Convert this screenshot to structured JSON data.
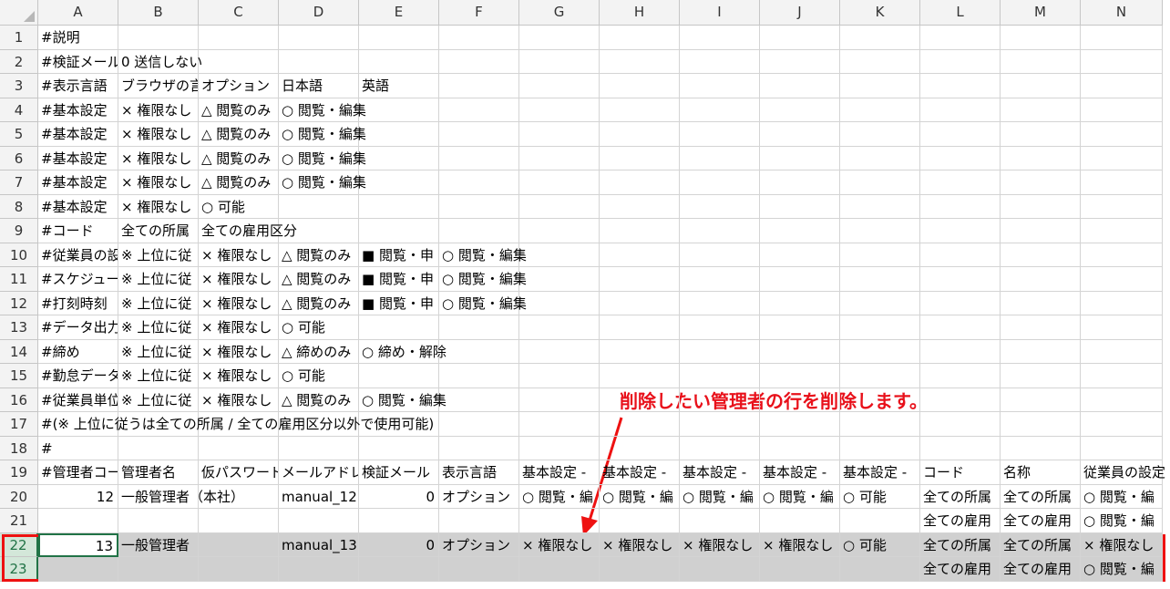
{
  "columns": [
    "A",
    "B",
    "C",
    "D",
    "E",
    "F",
    "G",
    "H",
    "I",
    "J",
    "K",
    "L",
    "M",
    "N"
  ],
  "rows": [
    {
      "n": "1",
      "cells": [
        "#説明",
        "",
        "",
        "",
        "",
        "",
        "",
        "",
        "",
        "",
        "",
        "",
        "",
        ""
      ]
    },
    {
      "n": "2",
      "cells": [
        "#検証メール",
        "0 送信しない",
        "",
        "",
        "",
        "",
        "",
        "",
        "",
        "",
        "",
        "",
        "",
        ""
      ]
    },
    {
      "n": "3",
      "cells": [
        "#表示言語",
        "ブラウザの言",
        "オプション",
        "日本語",
        "英語",
        "",
        "",
        "",
        "",
        "",
        "",
        "",
        "",
        ""
      ]
    },
    {
      "n": "4",
      "cells": [
        "#基本設定",
        "× 権限なし",
        "△ 閲覧のみ",
        "○ 閲覧・編集",
        "",
        "",
        "",
        "",
        "",
        "",
        "",
        "",
        "",
        ""
      ]
    },
    {
      "n": "5",
      "cells": [
        "#基本設定",
        "× 権限なし",
        "△ 閲覧のみ",
        "○ 閲覧・編集",
        "",
        "",
        "",
        "",
        "",
        "",
        "",
        "",
        "",
        ""
      ]
    },
    {
      "n": "6",
      "cells": [
        "#基本設定",
        "× 権限なし",
        "△ 閲覧のみ",
        "○ 閲覧・編集",
        "",
        "",
        "",
        "",
        "",
        "",
        "",
        "",
        "",
        ""
      ]
    },
    {
      "n": "7",
      "cells": [
        "#基本設定",
        "× 権限なし",
        "△ 閲覧のみ",
        "○ 閲覧・編集",
        "",
        "",
        "",
        "",
        "",
        "",
        "",
        "",
        "",
        ""
      ]
    },
    {
      "n": "8",
      "cells": [
        "#基本設定",
        "× 権限なし",
        "○ 可能",
        "",
        "",
        "",
        "",
        "",
        "",
        "",
        "",
        "",
        "",
        ""
      ]
    },
    {
      "n": "9",
      "cells": [
        "#コード",
        "全ての所属",
        "全ての雇用区分",
        "",
        "",
        "",
        "",
        "",
        "",
        "",
        "",
        "",
        "",
        ""
      ]
    },
    {
      "n": "10",
      "cells": [
        "#従業員の設",
        "※ 上位に従",
        "× 権限なし",
        "△ 閲覧のみ",
        "■ 閲覧・申",
        "○ 閲覧・編集",
        "",
        "",
        "",
        "",
        "",
        "",
        "",
        ""
      ]
    },
    {
      "n": "11",
      "cells": [
        "#スケジュール",
        "※ 上位に従",
        "× 権限なし",
        "△ 閲覧のみ",
        "■ 閲覧・申",
        "○ 閲覧・編集",
        "",
        "",
        "",
        "",
        "",
        "",
        "",
        ""
      ]
    },
    {
      "n": "12",
      "cells": [
        "#打刻時刻",
        "※ 上位に従",
        "× 権限なし",
        "△ 閲覧のみ",
        "■ 閲覧・申",
        "○ 閲覧・編集",
        "",
        "",
        "",
        "",
        "",
        "",
        "",
        ""
      ]
    },
    {
      "n": "13",
      "cells": [
        "#データ出力",
        "※ 上位に従",
        "× 権限なし",
        "○ 可能",
        "",
        "",
        "",
        "",
        "",
        "",
        "",
        "",
        "",
        ""
      ]
    },
    {
      "n": "14",
      "cells": [
        "#締め",
        "※ 上位に従",
        "× 権限なし",
        "△ 締めのみ",
        "○ 締め・解除",
        "",
        "",
        "",
        "",
        "",
        "",
        "",
        "",
        ""
      ]
    },
    {
      "n": "15",
      "cells": [
        "#勤怠データ",
        "※ 上位に従",
        "× 権限なし",
        "○ 可能",
        "",
        "",
        "",
        "",
        "",
        "",
        "",
        "",
        "",
        ""
      ]
    },
    {
      "n": "16",
      "cells": [
        "#従業員単位",
        "※ 上位に従",
        "× 権限なし",
        "△ 閲覧のみ",
        "○ 閲覧・編集",
        "",
        "",
        "",
        "",
        "",
        "",
        "",
        "",
        ""
      ]
    },
    {
      "n": "17",
      "cells": [
        "#(※ 上位に従うは全ての所属 / 全ての雇用区分以外で使用可能)",
        "",
        "",
        "",
        "",
        "",
        "",
        "",
        "",
        "",
        "",
        "",
        "",
        ""
      ]
    },
    {
      "n": "18",
      "cells": [
        "#",
        "",
        "",
        "",
        "",
        "",
        "",
        "",
        "",
        "",
        "",
        "",
        "",
        ""
      ]
    },
    {
      "n": "19",
      "cells": [
        "#管理者コード",
        "管理者名",
        "仮パスワード",
        "メールアドレス",
        "検証メール",
        "表示言語",
        "基本設定 -",
        "基本設定 -",
        "基本設定 -",
        "基本設定 -",
        "基本設定 -",
        "コード",
        "名称",
        "従業員の設定"
      ]
    },
    {
      "n": "20",
      "cells": [
        "12",
        "一般管理者（本社）",
        "",
        "manual_12",
        "0",
        "オプション",
        "○ 閲覧・編",
        "○ 閲覧・編",
        "○ 閲覧・編",
        "○ 閲覧・編",
        "○ 可能",
        "全ての所属",
        "全ての所属",
        "○ 閲覧・編"
      ]
    },
    {
      "n": "21",
      "cells": [
        "",
        "",
        "",
        "",
        "",
        "",
        "",
        "",
        "",
        "",
        "",
        "全ての雇用",
        "全ての雇用",
        "○ 閲覧・編"
      ]
    },
    {
      "n": "22",
      "cells": [
        "13",
        "一般管理者（大阪）",
        "",
        "manual_13",
        "0",
        "オプション",
        "× 権限なし",
        "× 権限なし",
        "× 権限なし",
        "× 権限なし",
        "○ 可能",
        "全ての所属",
        "全ての所属",
        "× 権限なし"
      ]
    },
    {
      "n": "23",
      "cells": [
        "",
        "",
        "",
        "",
        "",
        "",
        "",
        "",
        "",
        "",
        "",
        "全ての雇用",
        "全ての雇用",
        "○ 閲覧・編"
      ]
    }
  ],
  "annotation": "削除したい管理者の行を削除します。",
  "colors": {
    "highlight": "#ee1111",
    "selected_row": "#d0d0d0",
    "row_header_selected": "#217346"
  }
}
